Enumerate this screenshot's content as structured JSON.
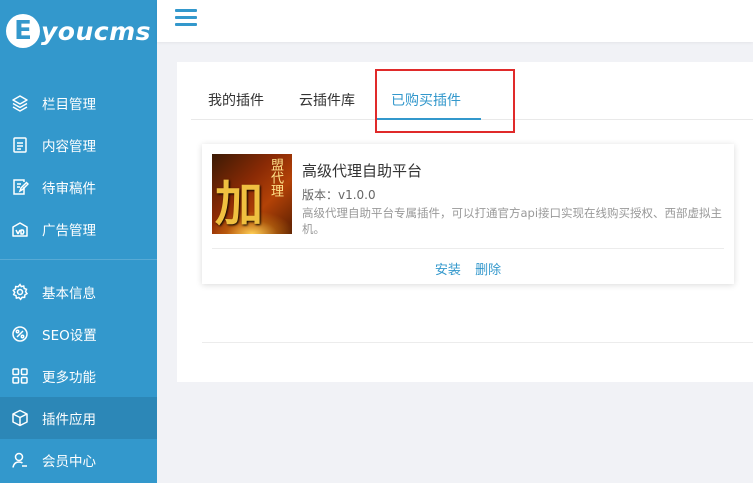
{
  "brand": {
    "logo_letter": "E",
    "logo_text": "youcms"
  },
  "sidebar": {
    "items": [
      {
        "label": "栏目管理",
        "icon": "layers-icon"
      },
      {
        "label": "内容管理",
        "icon": "document-icon"
      },
      {
        "label": "待审稿件",
        "icon": "edit-document-icon"
      },
      {
        "label": "广告管理",
        "icon": "ad-icon"
      },
      {
        "label": "基本信息",
        "icon": "gear-icon"
      },
      {
        "label": "SEO设置",
        "icon": "seo-icon"
      },
      {
        "label": "更多功能",
        "icon": "grid-icon"
      },
      {
        "label": "插件应用",
        "icon": "cube-icon",
        "active": true
      },
      {
        "label": "会员中心",
        "icon": "user-icon"
      }
    ]
  },
  "tabs": [
    {
      "label": "我的插件"
    },
    {
      "label": "云插件库"
    },
    {
      "label": "已购买插件",
      "active": true
    }
  ],
  "plugin": {
    "title": "高级代理自助平台",
    "version": "版本：v1.0.0",
    "description": "高级代理自助平台专属插件，可以打通官方api接口实现在线购买授权、西部虚拟主机。",
    "thumb_big": "加",
    "thumb_vertical": "盟代理",
    "install_label": "安装",
    "delete_label": "删除"
  },
  "colors": {
    "accent": "#3398cc",
    "sidebar_active": "#2c87b7",
    "highlight": "#e02a2a"
  }
}
